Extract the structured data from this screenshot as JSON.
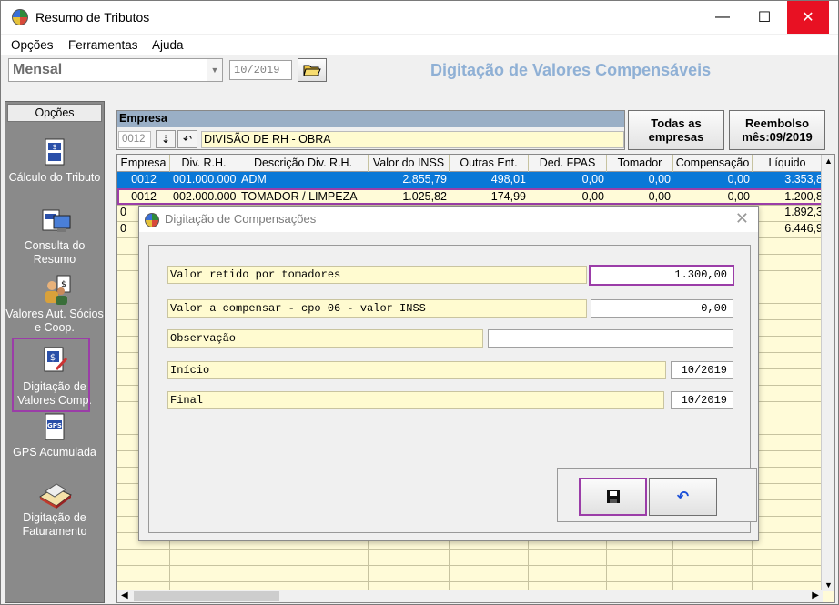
{
  "window": {
    "title": "Resumo de Tributos",
    "minimize_glyph": "—",
    "maximize_glyph": "☐",
    "close_glyph": "✕",
    "close_color": "#e81123"
  },
  "menu": [
    "Opções",
    "Ferramentas",
    "Ajuda"
  ],
  "toolbar": {
    "period_type": "Mensal",
    "period": "10/2019",
    "screen_title": "Digitação de Valores Compensáveis"
  },
  "sidebar": {
    "header": "Opções",
    "items": [
      {
        "label": "Cálculo do Tributo",
        "icon": "calculator-document-icon"
      },
      {
        "label": "Consulta do Resumo",
        "icon": "computer-document-icon"
      },
      {
        "label": "Valores Aut. Sócios e Coop.",
        "icon": "people-money-icon"
      },
      {
        "label": "Digitação de Valores Comp.",
        "icon": "edit-document-icon",
        "selected": true
      },
      {
        "label": "GPS Acumulada",
        "icon": "gps-document-icon"
      },
      {
        "label": "Digitação de Faturamento",
        "icon": "keyboard-book-icon"
      }
    ]
  },
  "empresa": {
    "header": "Empresa",
    "code": "0012",
    "name": "DIVISÃO DE RH - OBRA",
    "all_button_line1": "Todas as",
    "all_button_line2": "empresas",
    "reembolso_line1": "Reembolso",
    "reembolso_line2": "mês:09/2019"
  },
  "grid": {
    "columns": [
      "Empresa",
      "Div. R.H.",
      "Descrição Div. R.H.",
      "Valor do INSS",
      "Outras Ent.",
      "Ded. FPAS",
      "Tomador",
      "Compensação",
      "Líquido"
    ],
    "rows": [
      {
        "empresa": "0012",
        "div": "001.000.000",
        "descricao": "ADM",
        "inss": "2.855,79",
        "outras": "498,01",
        "fpas": "0,00",
        "tomador": "0,00",
        "compensacao": "0,00",
        "liquido": "3.353,8",
        "selected": true
      },
      {
        "empresa": "0012",
        "div": "002.000.000",
        "descricao": "TOMADOR / LIMPEZA",
        "inss": "1.025,82",
        "outras": "174,99",
        "fpas": "0,00",
        "tomador": "0,00",
        "compensacao": "0,00",
        "liquido": "1.200,8",
        "highlighted": true
      },
      {
        "empresa": "0",
        "div": "",
        "descricao": "",
        "inss": "",
        "outras": "",
        "fpas": "",
        "tomador": "",
        "compensacao": "",
        "liquido": "1.892,3"
      },
      {
        "empresa": "0",
        "div": "",
        "descricao": "",
        "inss": "",
        "outras": "",
        "fpas": "",
        "tomador": "",
        "compensacao": "",
        "liquido": "6.446,9"
      }
    ],
    "selected_color": "#0a78d7"
  },
  "dialog": {
    "title": "Digitação de Compensações",
    "close_glyph": "✕",
    "fields": [
      {
        "label": "Valor retido por tomadores",
        "value": "1.300,00",
        "highlighted": true
      },
      {
        "label": "Valor a compensar - cpo 06 - valor INSS",
        "value": "0,00"
      },
      {
        "label": "Observação",
        "value": ""
      },
      {
        "label": "Início",
        "value": "10/2019"
      },
      {
        "label": "Final",
        "value": "10/2019"
      }
    ],
    "save_icon": "floppy-disk-icon",
    "undo_icon": "undo-arrow-icon",
    "highlight_color": "#9b3da8"
  }
}
